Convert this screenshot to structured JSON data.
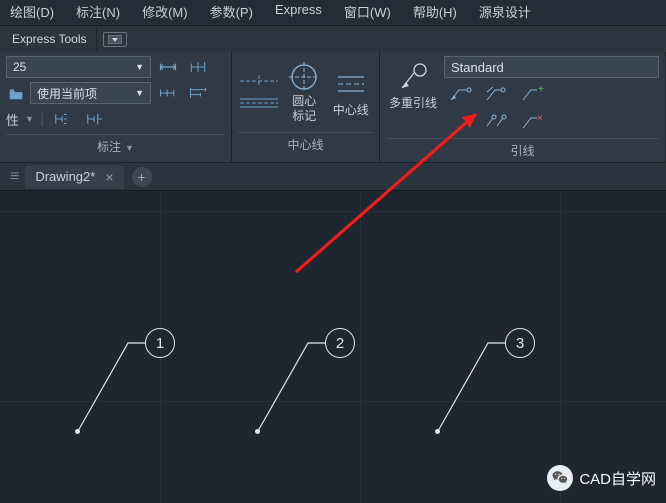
{
  "menubar": {
    "draw": "绘图(D)",
    "annotate": "标注(N)",
    "modify": "修改(M)",
    "params": "参数(P)",
    "express": "Express",
    "window": "窗口(W)",
    "help": "帮助(H)",
    "yuanquan": "源泉设计"
  },
  "tabstrip": {
    "expresstools": "Express Tools"
  },
  "ribbon": {
    "dim": {
      "style_value": "25",
      "usecurrent": "使用当前项",
      "prop_label": "性",
      "panel_title": "标注"
    },
    "centerline": {
      "centermark": "圆心\n标记",
      "centerline": "中心线",
      "panel_title": "中心线"
    },
    "leader": {
      "multileader": "多重引线",
      "style_value": "Standard",
      "panel_title": "引线"
    }
  },
  "filetabs": {
    "active": "Drawing2*"
  },
  "canvas": {
    "balloons": [
      "1",
      "2",
      "3"
    ]
  },
  "watermark": {
    "text": "CAD自学网"
  }
}
